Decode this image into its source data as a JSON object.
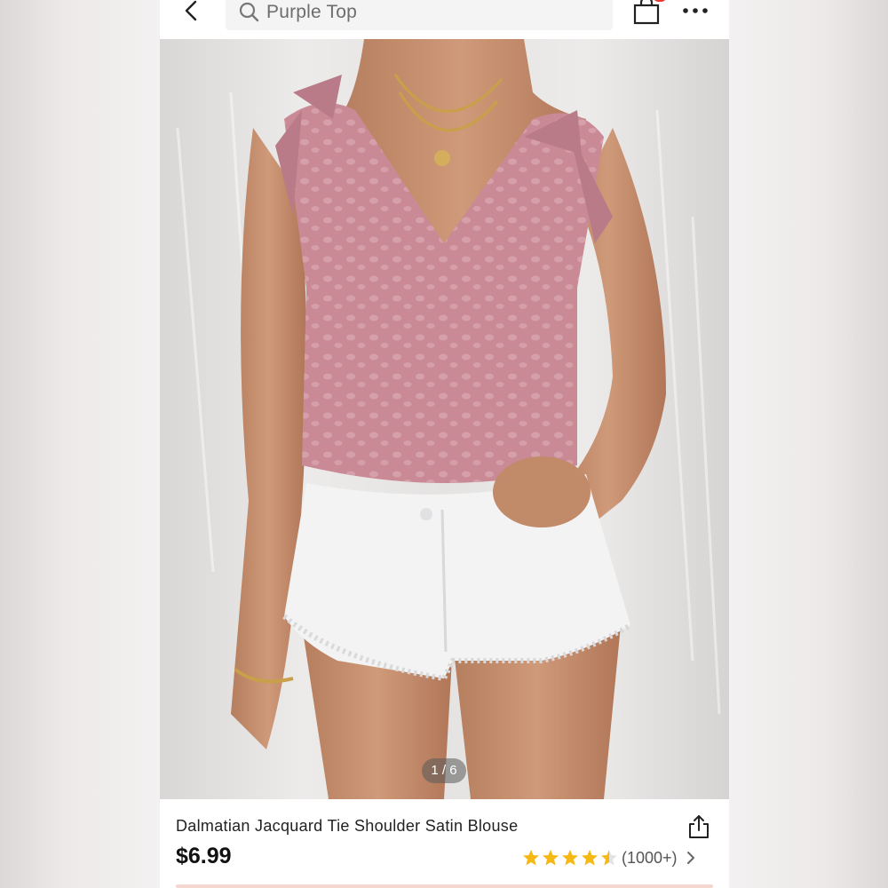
{
  "search": {
    "query": "Purple Top"
  },
  "gallery": {
    "indicator": "1 / 6"
  },
  "product": {
    "title": "Dalmatian Jacquard Tie Shoulder Satin Blouse",
    "price": "$6.99",
    "rating_stars": 4.5,
    "review_count": "(1000+)"
  },
  "icons": {
    "back": "chevron-left-icon",
    "search": "search-icon",
    "bag": "shopping-bag-icon",
    "more": "more-dots-icon",
    "share": "share-icon",
    "star": "star-icon",
    "chevron": "chevron-right-icon"
  },
  "colors": {
    "star": "#f5b814",
    "badge": "#e8382f",
    "blouse": "#c98a96"
  }
}
